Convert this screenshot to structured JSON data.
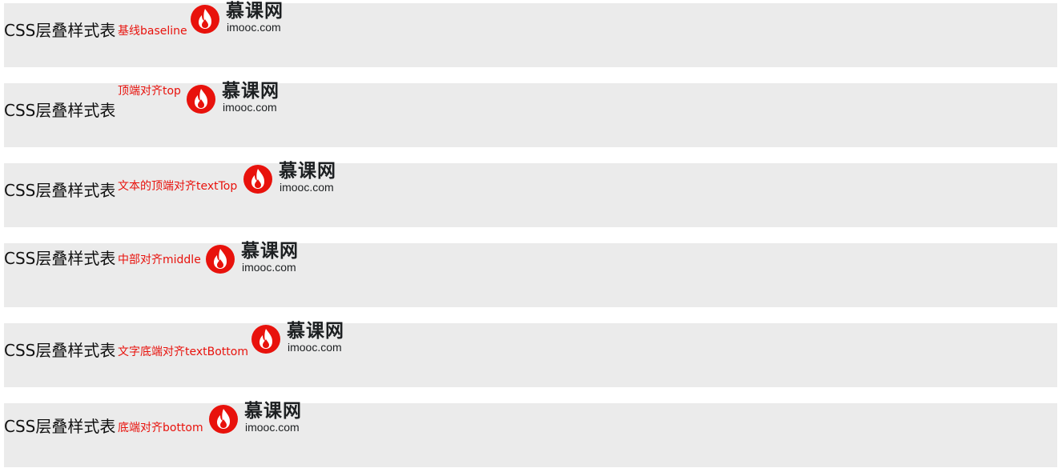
{
  "rows": [
    {
      "main": "CSS层叠样式表",
      "label": "基线baseline",
      "logo_cn": "慕课网",
      "logo_en": "imooc.com"
    },
    {
      "main": "CSS层叠样式表",
      "label": "顶端对齐top",
      "logo_cn": "慕课网",
      "logo_en": "imooc.com"
    },
    {
      "main": "CSS层叠样式表",
      "label": "文本的顶端对齐textTop",
      "logo_cn": "慕课网",
      "logo_en": "imooc.com"
    },
    {
      "main": "CSS层叠样式表",
      "label": "中部对齐middle",
      "logo_cn": "慕课网",
      "logo_en": "imooc.com"
    },
    {
      "main": "CSS层叠样式表",
      "label": "文字底端对齐textBottom",
      "logo_cn": "慕课网",
      "logo_en": "imooc.com"
    },
    {
      "main": "CSS层叠样式表",
      "label": "底端对齐bottom",
      "logo_cn": "慕课网",
      "logo_en": "imooc.com"
    }
  ],
  "colors": {
    "row_bg": "#ebebeb",
    "label": "#e8120c",
    "logo_red": "#e8120c",
    "text": "#111111"
  },
  "icons": {
    "logo": "imooc-flame-logo-icon"
  }
}
